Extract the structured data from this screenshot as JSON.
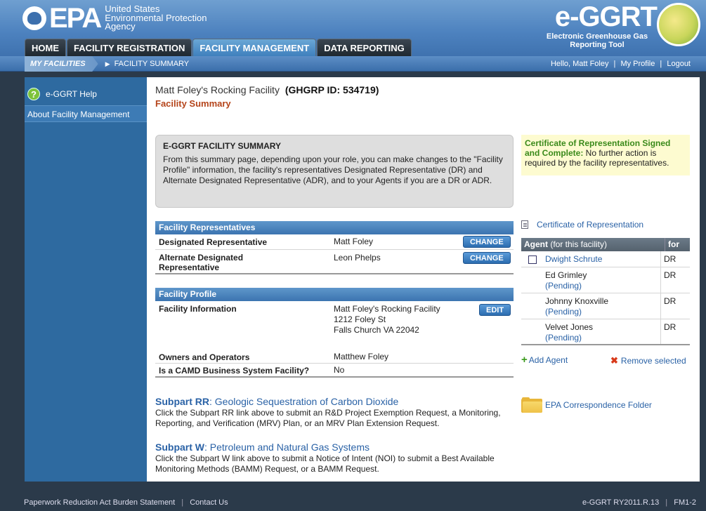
{
  "header": {
    "epa_text": "EPA",
    "agency_lines": [
      "United States",
      "Environmental Protection",
      "Agency"
    ],
    "eggrt_title": "e-GGRT",
    "eggrt_subtitle": "Electronic Greenhouse Gas Reporting Tool"
  },
  "nav": {
    "tabs": [
      {
        "label": "HOME"
      },
      {
        "label": "FACILITY REGISTRATION"
      },
      {
        "label": "FACILITY MANAGEMENT"
      },
      {
        "label": "DATA REPORTING"
      }
    ],
    "active_tab": "FACILITY MANAGEMENT"
  },
  "subnav": {
    "my_facilities": "MY FACILITIES",
    "current": "FACILITY SUMMARY",
    "greeting": "Hello, Matt Foley",
    "my_profile": "My Profile",
    "logout": "Logout"
  },
  "sidebar": {
    "help": "e-GGRT Help",
    "about": "About Facility Management"
  },
  "main": {
    "facility_name": "Matt Foley's Rocking Facility",
    "ghgrp_id": "(GHGRP ID: 534719)",
    "subtitle": "Facility Summary",
    "summary": {
      "title": "E-GGRT FACILITY SUMMARY",
      "text": "From this summary page, depending upon your role, you can make changes to the \"Facility Profile\" information, the facility's representatives Designated Representative (DR) and Alternate Designated Representative (ADR), and to your Agents if you are a DR or ADR."
    },
    "cert_notice": {
      "head": "Certificate of Representation Signed and Complete:",
      "text": " No further action is required by the facility representatives."
    },
    "reps": {
      "title": "Facility Representatives",
      "dr_label": "Designated Representative",
      "dr_value": "Matt Foley",
      "adr_label": "Alternate Designated Representative",
      "adr_value": "Leon Phelps",
      "change_label": "CHANGE"
    },
    "profile": {
      "title": "Facility Profile",
      "info_label": "Facility Information",
      "info_lines": [
        "Matt Foley's Rocking Facility",
        "1212 Foley St",
        "Falls Church VA 22042"
      ],
      "edit_label": "EDIT",
      "owners_label": "Owners and Operators",
      "owners_value": "Matthew Foley",
      "camd_label": "Is a CAMD Business System Facility?",
      "camd_value": "No"
    },
    "cert_link": "Certificate of Representation",
    "agents": {
      "col_agent": "Agent",
      "col_agent_sub": " (for this facility)",
      "col_for": "for",
      "rows": [
        {
          "name": "Dwight Schrute",
          "status": "",
          "role": "DR"
        },
        {
          "name": "Ed Grimley",
          "status": "(Pending)",
          "role": "DR"
        },
        {
          "name": "Johnny Knoxville",
          "status": "(Pending)",
          "role": "DR"
        },
        {
          "name": "Velvet Jones",
          "status": "(Pending)",
          "role": "DR"
        }
      ],
      "add": "Add Agent",
      "remove": "Remove selected"
    },
    "correspondence": "EPA Correspondence Folder",
    "subpart_rr": {
      "code": "Subpart RR",
      "name": ": Geologic Sequestration of Carbon Dioxide",
      "desc": "Click the Subpart RR link above to submit an R&D Project Exemption Request, a Monitoring, Reporting, and Verification (MRV) Plan, or an MRV Plan Extension Request."
    },
    "subpart_w": {
      "code": "Subpart W",
      "name": ": Petroleum and Natural Gas Systems",
      "desc": "Click the Subpart W link above to submit a Notice of Intent (NOI) to submit a Best Available Monitoring Methods (BAMM) Request, or a BAMM Request."
    }
  },
  "footer": {
    "paperwork": "Paperwork Reduction Act Burden Statement",
    "contact": "Contact Us",
    "version": "e-GGRT RY2011.R.13",
    "screen_id": "FM1-2"
  },
  "colors": {
    "link": "#2a62a6",
    "accent_green": "#3a8a1a",
    "subtitle_red": "#b5451b"
  }
}
